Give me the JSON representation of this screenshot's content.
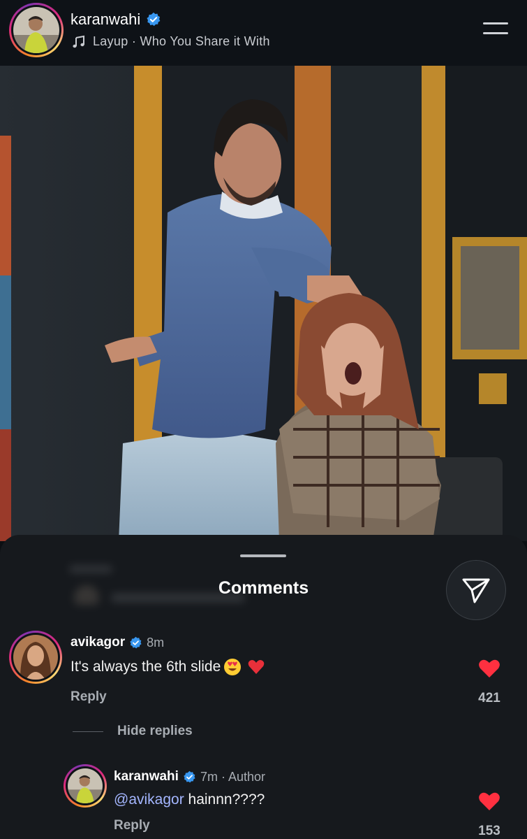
{
  "header": {
    "username": "karanwahi",
    "audio": "Layup · Who You Share it With"
  },
  "sheet": {
    "title": "Comments"
  },
  "comments": [
    {
      "username": "avikagor",
      "time": "8m",
      "text": "It's always the 6th slide",
      "reply_label": "Reply",
      "likes": "421"
    }
  ],
  "replies_toggle": "Hide replies",
  "replies": [
    {
      "username": "karanwahi",
      "time_author": "7m · Author",
      "mention": "@avikagor",
      "text": " hainnn????",
      "reply_label": "Reply",
      "likes": "153"
    }
  ],
  "colors": {
    "background": "#0e1217",
    "sheet": "#16191d",
    "verified": "#3897f0",
    "like_red": "#ff3040",
    "mention": "#a4b6ff"
  },
  "icons": [
    "verified-badge-icon",
    "music-note-icon",
    "menu-icon",
    "send-icon",
    "heart-icon"
  ]
}
